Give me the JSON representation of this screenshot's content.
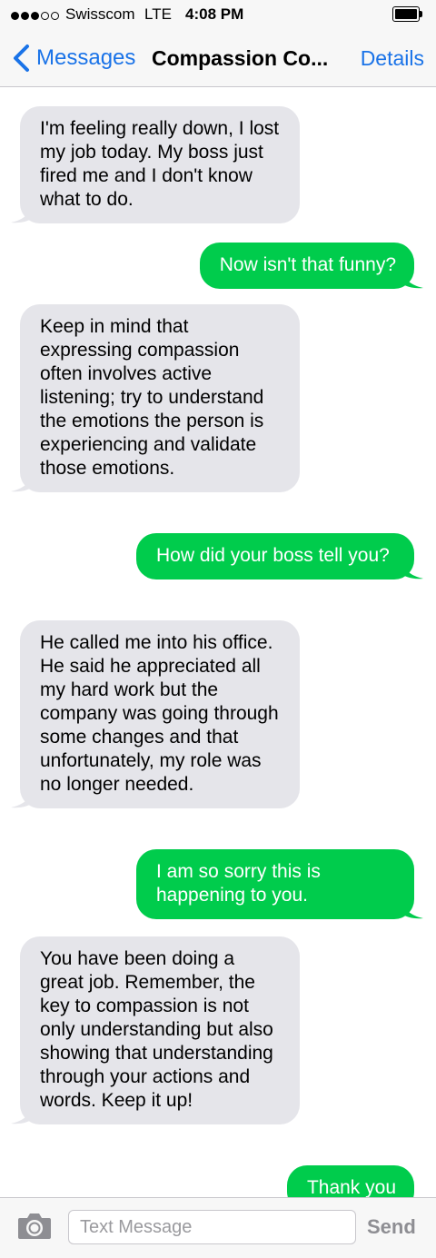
{
  "status_bar": {
    "signal_bars_filled": 3,
    "signal_bars_total": 5,
    "carrier": "Swisscom",
    "network": "LTE",
    "time": "4:08 PM",
    "battery_level": 1.0
  },
  "nav": {
    "back_label": "Messages",
    "title": "Compassion Co...",
    "details_label": "Details",
    "accent_color": "#1a73e8"
  },
  "colors": {
    "incoming_bubble": "#e5e5ea",
    "outgoing_bubble": "#00cc4c"
  },
  "messages": [
    {
      "direction": "incoming",
      "text": "I'm feeling really down, I lost my job today. My boss just fired me and I don't know what to do."
    },
    {
      "direction": "outgoing",
      "text": "Now isn't that funny?"
    },
    {
      "direction": "incoming",
      "text": "Keep in mind that expressing compassion often involves active listening; try to understand the emotions the person is experiencing and validate those emotions."
    },
    {
      "direction": "outgoing",
      "text": "How did your boss tell you?"
    },
    {
      "direction": "incoming",
      "text": "He called me into his office. He said he appreciated all my hard work but the company was going through some changes and that unfortunately, my role was no longer needed."
    },
    {
      "direction": "outgoing",
      "text": "I am so sorry this is happening to you."
    },
    {
      "direction": "incoming",
      "text": "You have been doing a great job. Remember, the key to compassion is not only understanding but also showing that understanding through your actions and words. Keep it up!"
    },
    {
      "direction": "outgoing",
      "text": "Thank you"
    }
  ],
  "input_bar": {
    "camera_icon": "camera-icon",
    "placeholder": "Text Message",
    "value": "",
    "send_label": "Send"
  }
}
